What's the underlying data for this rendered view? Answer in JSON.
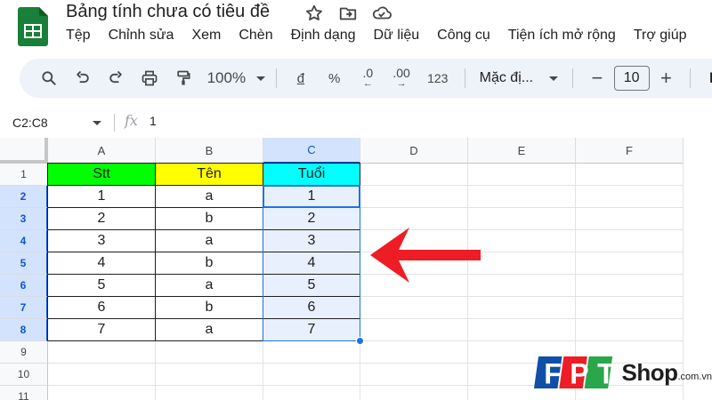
{
  "app": {
    "title": "Bảng tính chưa có tiêu đề",
    "brand_color": "#188038"
  },
  "menu": [
    "Tệp",
    "Chỉnh sửa",
    "Xem",
    "Chèn",
    "Định dạng",
    "Dữ liệu",
    "Công cụ",
    "Tiện ích mở rộng",
    "Trợ giúp"
  ],
  "toolbar": {
    "zoom": "100%",
    "currency": "đ",
    "percent": "%",
    "decrease_decimal": ".0",
    "increase_decimal": ".00",
    "number_format": "123",
    "font": "Mặc đị...",
    "font_size": "10",
    "decrease_font": "−",
    "increase_font": "+",
    "bold": "B"
  },
  "formula_bar": {
    "name_box": "C2:C8",
    "fx_label": "fx",
    "value": "1"
  },
  "columns": [
    "A",
    "B",
    "C",
    "D",
    "E",
    "F"
  ],
  "rows": [
    "1",
    "2",
    "3",
    "4",
    "5",
    "6",
    "7",
    "8",
    "9",
    "10",
    "11"
  ],
  "headers": [
    "Stt",
    "Tên",
    "Tuổi"
  ],
  "header_colors": [
    "#00ff00",
    "#ffff00",
    "#00ffff"
  ],
  "table": [
    [
      "1",
      "a",
      "1"
    ],
    [
      "2",
      "b",
      "2"
    ],
    [
      "3",
      "a",
      "3"
    ],
    [
      "4",
      "b",
      "4"
    ],
    [
      "5",
      "a",
      "5"
    ],
    [
      "6",
      "b",
      "6"
    ],
    [
      "7",
      "a",
      "7"
    ]
  ],
  "selection": {
    "range": "C2:C8",
    "color": "#1a73e8"
  },
  "annotation": {
    "arrow_color": "#ee1c25"
  },
  "watermark": {
    "logo_letters": "FPT",
    "shop": "Shop",
    "domain": ".com.vn"
  }
}
